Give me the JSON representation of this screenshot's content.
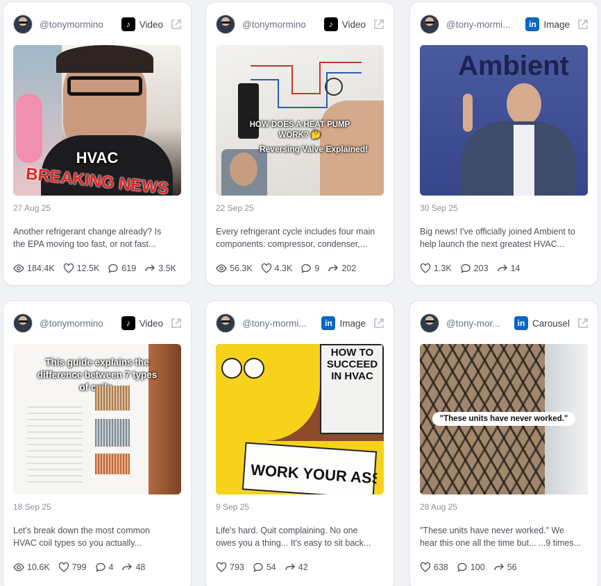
{
  "cards": [
    {
      "handle": "@tonymormino",
      "platform": "tiktok",
      "type": "Video",
      "date": "27 Aug 25",
      "caption1": "Another refrigerant change already? Is",
      "caption2": "the EPA moving too fast, or not fast...",
      "views": "184.4K",
      "likes": "12.5K",
      "comments": "619",
      "shares": "3.5K",
      "thumb_text1": "HVAC",
      "thumb_text2": "BREAKING NEWS"
    },
    {
      "handle": "@tonymormino",
      "platform": "tiktok",
      "type": "Video",
      "date": "22 Sep 25",
      "caption1": "Every refrigerant cycle includes four main",
      "caption2": "components: compressor, condenser,...",
      "views": "56.3K",
      "likes": "4.3K",
      "comments": "9",
      "shares": "202",
      "thumb_text1": "HOW DOES A HEAT PUMP WORK? 🤔",
      "thumb_text2": "Reversing Valve Explained!"
    },
    {
      "handle": "@tony-mormi...",
      "platform": "linkedin",
      "type": "Image",
      "date": "30 Sep 25",
      "caption1": "Big news! I've officially joined Ambient to",
      "caption2": "help launch the next greatest HVAC...",
      "likes": "1.3K",
      "comments": "203",
      "shares": "14",
      "thumb_text1": "Ambient"
    },
    {
      "handle": "@tonymormino",
      "platform": "tiktok",
      "type": "Video",
      "date": "18 Sep 25",
      "caption1": "Let's break down the most common",
      "caption2": "HVAC coil types so you actually...",
      "views": "10.6K",
      "likes": "799",
      "comments": "4",
      "shares": "48",
      "thumb_text1": "This guide explains the difference between 7 types of coils."
    },
    {
      "handle": "@tony-mormi...",
      "platform": "linkedin",
      "type": "Image",
      "date": "9 Sep 25",
      "caption1": "Life's hard. Quit complaining. No one",
      "caption2": "owes you a thing... It's easy to sit back...",
      "likes": "793",
      "comments": "54",
      "shares": "42",
      "thumb_text1": "HOW TO SUCCEED IN HVAC",
      "thumb_text2": "WORK YOUR ASS OFF"
    },
    {
      "handle": "@tony-mor...",
      "platform": "linkedin",
      "type": "Carousel",
      "date": "28 Aug 25",
      "caption1": "\"These units have never worked.\" We",
      "caption2": "hear this one all the time but... ...9 times...",
      "likes": "638",
      "comments": "100",
      "shares": "56",
      "thumb_text1": "\"These units have never worked.\""
    }
  ],
  "colors": {
    "tiktok": "#000000",
    "linkedin": "#0a66c2",
    "card_bg": "#ffffff",
    "page_bg": "#f1f3f6"
  }
}
